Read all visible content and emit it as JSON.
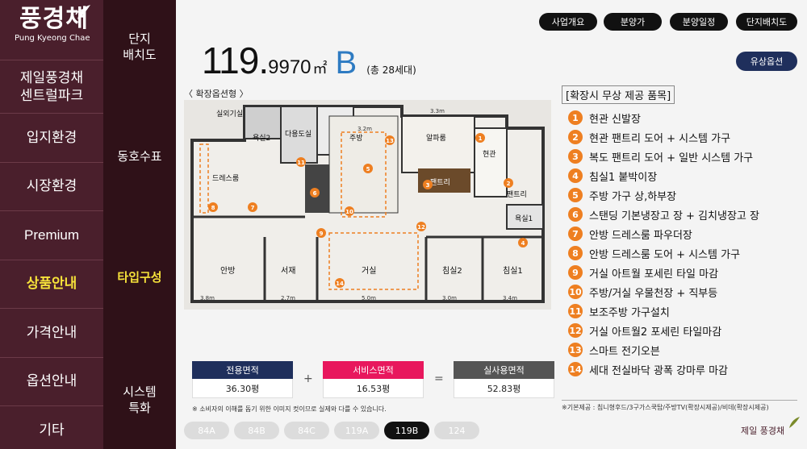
{
  "brand": {
    "name": "풍경채",
    "sub": "Pung Kyeong Chae"
  },
  "nav": {
    "items": [
      {
        "label": "제일풍경채\n센트럴파크"
      },
      {
        "label": "입지환경"
      },
      {
        "label": "시장환경"
      },
      {
        "label": "Premium"
      },
      {
        "label": "상품안내"
      },
      {
        "label": "가격안내"
      },
      {
        "label": "옵션안내"
      },
      {
        "label": "기타"
      }
    ]
  },
  "subnav": {
    "items": [
      {
        "label": "단지\n배치도"
      },
      {
        "label": "동호수표"
      },
      {
        "label": "타입구성"
      },
      {
        "label": "시스템\n특화"
      }
    ]
  },
  "top_buttons": [
    "사업개요",
    "분양가",
    "분양일정",
    "단지배치도"
  ],
  "option_button": "유상옵션",
  "title": {
    "area_int": "119.",
    "area_dec": "9970",
    "unit": "㎡",
    "type": "B",
    "households": "(총 28세대)"
  },
  "plan": {
    "label": "〈 확장옵션형 〉",
    "rooms": [
      "실외기실",
      "욕실2",
      "다용도실",
      "주방",
      "알파룸",
      "현관",
      "드레스룸",
      "팬트리",
      "팬트리",
      "욕실1",
      "안방",
      "서재",
      "거실",
      "침실2",
      "침실1"
    ],
    "dims_top": [
      "3.2m",
      "3.3m"
    ],
    "dims_bottom": [
      "3.8m",
      "2.7m",
      "5.0m",
      "3.0m",
      "3.4m"
    ],
    "dims_side": [
      "4.1m",
      "3.4m",
      "3.7m",
      "3.6m",
      "3.6m",
      "2.9m",
      "4.8m"
    ]
  },
  "summary": {
    "exclusive": {
      "label": "전용면적",
      "value": "36.30평"
    },
    "service": {
      "label": "서비스면적",
      "value": "16.53평"
    },
    "actual": {
      "label": "실사용면적",
      "value": "52.83평"
    },
    "plus": "+",
    "equals": "="
  },
  "note_left": "※ 소비자의 이해를 돕기 위한 이미지 컷이므로 실제와 다를 수 있습니다.",
  "type_tabs": [
    {
      "label": "84A",
      "active": false
    },
    {
      "label": "84B",
      "active": false
    },
    {
      "label": "84C",
      "active": false
    },
    {
      "label": "119A",
      "active": false
    },
    {
      "label": "119B",
      "active": true
    },
    {
      "label": "124",
      "active": false
    }
  ],
  "free_items": {
    "title": "[확장시 무상 제공 품목]",
    "items": [
      "현관 신발장",
      "현관 팬트리 도어 + 시스템 가구",
      "복도 팬트리 도어 + 일반 시스템 가구",
      "침실1 붙박이장",
      "주방 가구 상,하부장",
      "스탠딩 기본냉장고 장 + 김치냉장고 장",
      "안방 드레스룸 파우더장",
      "안방 드레스룸 도어 + 시스템 가구",
      "거실 아트월 포세린 타일 마감",
      "주방/거실 우물천장 + 직부등",
      "보조주방 가구설치",
      "거실 아트월2 포세린 타일마감",
      "스마트 전기오븐",
      "세대 전실바닥 광폭 강마루 마감"
    ]
  },
  "note_right": "※기본제공 : 침니형후드/3구가스쿡탑/주방TV(확장시제공)/비데(확장시제공)",
  "brand_bottom": "제일 풍경채",
  "colors": {
    "nav_bg": "#4a1f2c",
    "subnav_bg": "#2f1118",
    "accent_yellow": "#f6e23a",
    "badge_orange": "#ee7f21",
    "exclusive_head": "#1f2f5c",
    "service_head": "#e8175d",
    "actual_head": "#555555",
    "type_blue": "#2e7bc2"
  }
}
